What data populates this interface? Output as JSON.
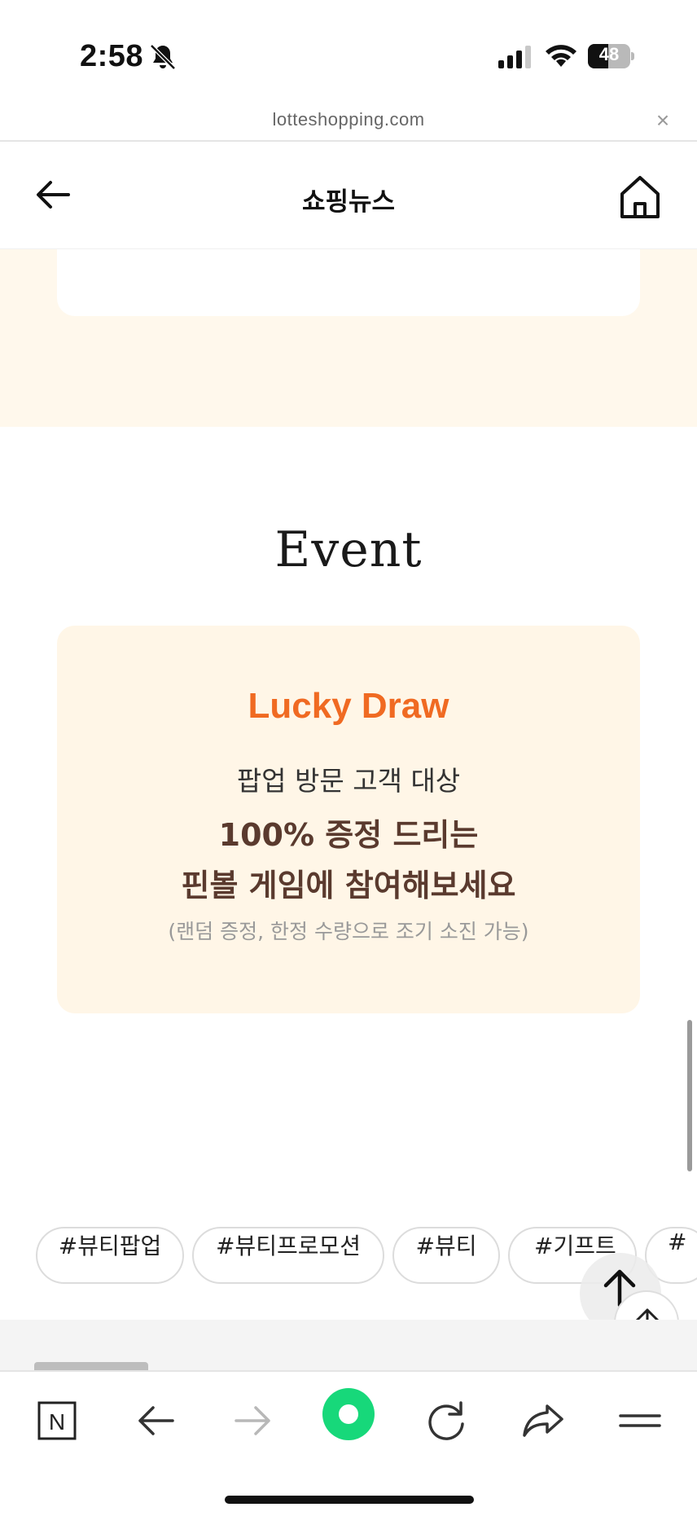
{
  "status_bar": {
    "time": "2:58",
    "battery": "48",
    "battery_level": 0.48,
    "icons": [
      "bell-off-icon",
      "signal-icon",
      "wifi-icon",
      "battery-icon"
    ]
  },
  "browser": {
    "url": "lotteshopping.com",
    "close_glyph": "×"
  },
  "header": {
    "title": "쇼핑뉴스"
  },
  "event": {
    "section_title": "Event",
    "card_title": "Lucky Draw",
    "line1": "팝업 방문 고객 대상",
    "line2": "100% 증정 드리는",
    "line3": "핀볼 게임에 참여해보세요",
    "note": "(랜덤 증정, 한정 수량으로 조기 소진 가능)"
  },
  "tags": [
    "#뷰티팝업",
    "#뷰티프로모션",
    "#뷰티",
    "#기프트",
    "#"
  ],
  "colors": {
    "accent_orange": "#f06a22",
    "cream_bg": "#fff8ec",
    "event_card_bg": "#fff6e7",
    "headline_brown": "#5a3a2e",
    "brand_green": "#17d87a"
  },
  "toolbar": {
    "n_label": "N",
    "icons": [
      "naver-n-icon",
      "back-arrow-icon",
      "forward-arrow-icon",
      "green-dot-icon",
      "reload-icon",
      "share-icon",
      "menu-icon"
    ]
  }
}
